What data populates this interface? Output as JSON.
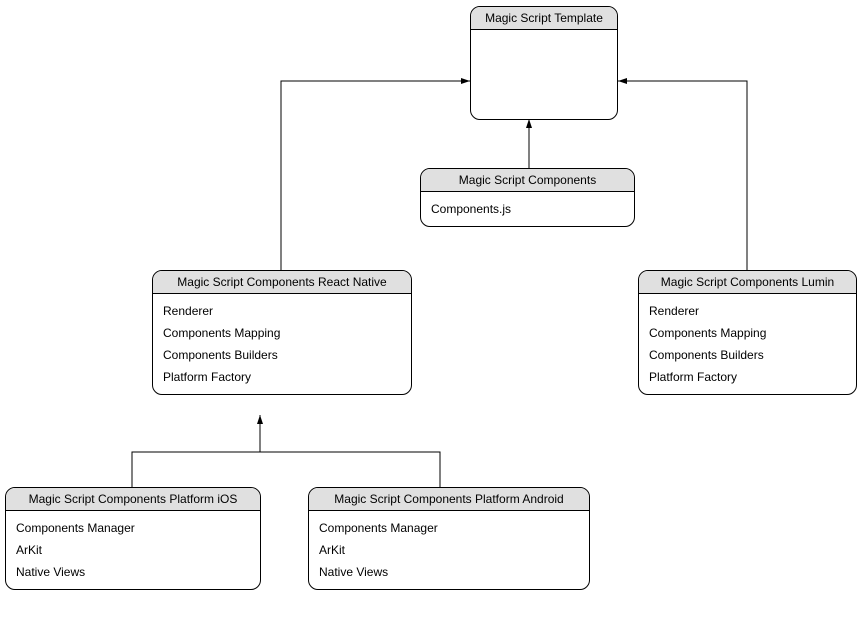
{
  "nodes": {
    "template": {
      "title": "Magic Script Template",
      "items": []
    },
    "components": {
      "title": "Magic Script Components",
      "items": [
        "Components.js"
      ]
    },
    "reactNative": {
      "title": "Magic Script Components React Native",
      "items": [
        "Renderer",
        "Components Mapping",
        "Components Builders",
        "Platform Factory"
      ]
    },
    "lumin": {
      "title": "Magic Script Components Lumin",
      "items": [
        "Renderer",
        "Components Mapping",
        "Components Builders",
        "Platform Factory"
      ]
    },
    "ios": {
      "title": "Magic Script Components Platform iOS",
      "items": [
        "Components Manager",
        "ArKit",
        "Native Views"
      ]
    },
    "android": {
      "title": "Magic Script Components Platform Android",
      "items": [
        "Components Manager",
        "ArKit",
        "Native Views"
      ]
    }
  }
}
